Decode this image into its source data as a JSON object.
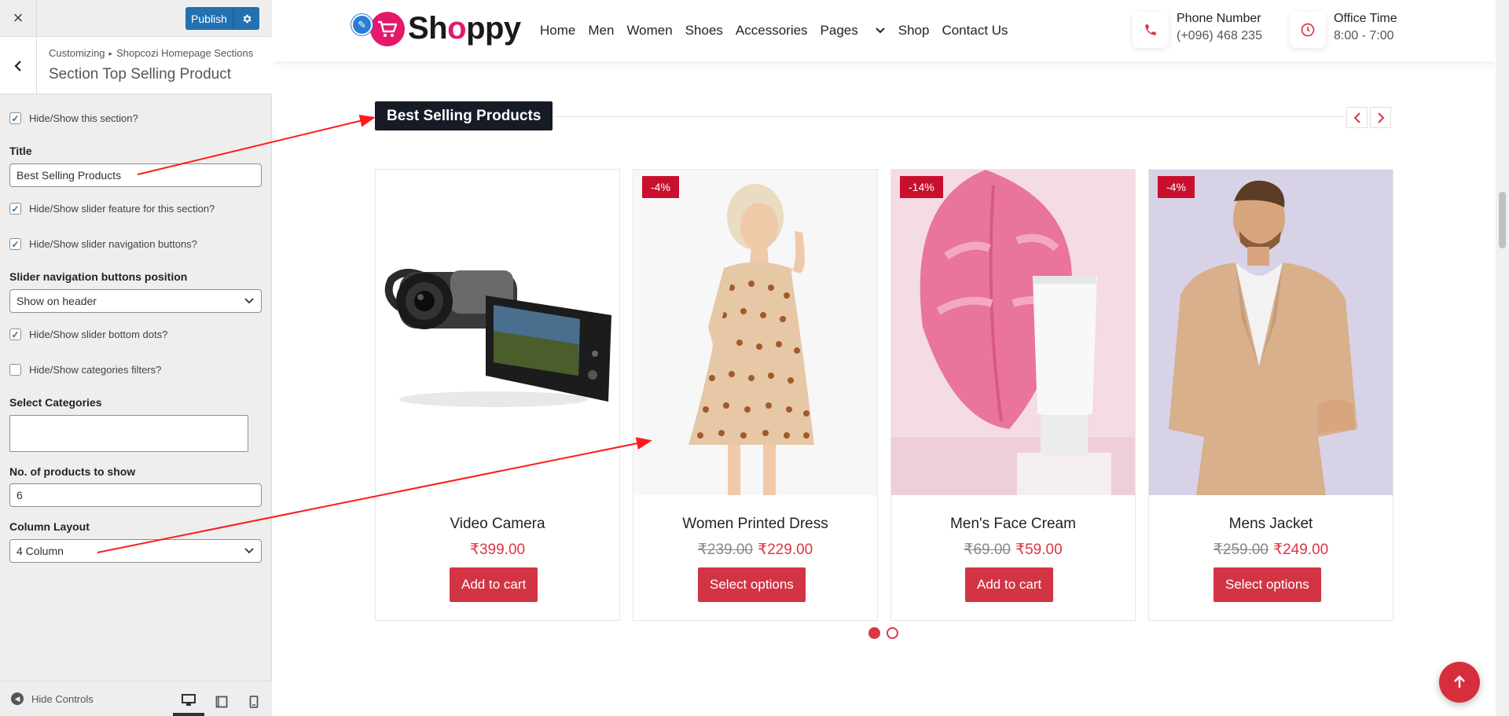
{
  "customizer": {
    "close_icon": "×",
    "publish_label": "Publish",
    "breadcrumb": {
      "root": "Customizing",
      "separator": "▸",
      "section": "Shopcozi Homepage Sections"
    },
    "panel_title": "Section Top Selling Product",
    "controls": {
      "show_section": {
        "label": "Hide/Show this section?",
        "checked": true
      },
      "title_label": "Title",
      "title_value": "Best Selling Products",
      "slider_feature": {
        "label": "Hide/Show slider feature for this section?",
        "checked": true
      },
      "slider_nav": {
        "label": "Hide/Show slider navigation buttons?",
        "checked": true
      },
      "nav_position_label": "Slider navigation buttons position",
      "nav_position_value": "Show on header",
      "slider_dots": {
        "label": "Hide/Show slider bottom dots?",
        "checked": true
      },
      "category_filters": {
        "label": "Hide/Show categories filters?",
        "checked": false
      },
      "select_categories_label": "Select Categories",
      "products_count_label": "No. of products to show",
      "products_count_value": "6",
      "column_layout_label": "Column Layout",
      "column_layout_value": "4 Column"
    },
    "footer": {
      "hide_controls": "Hide Controls",
      "devices": [
        "desktop",
        "tablet",
        "mobile"
      ],
      "active_device": "desktop"
    }
  },
  "site": {
    "logo": {
      "prefix": "Sh",
      "highlight": "o",
      "suffix": "ppy"
    },
    "nav": [
      "Home",
      "Men",
      "Women",
      "Shoes",
      "Accessories",
      "Pages",
      "Shop",
      "Contact Us"
    ],
    "phone": {
      "label": "Phone Number",
      "value": "(+096) 468 235"
    },
    "office": {
      "label": "Office Time",
      "value": "8:00 - 7:00"
    },
    "section_title": "Best Selling Products",
    "products": [
      {
        "name": "Video Camera",
        "badge": "",
        "old_price": "",
        "price": "₹399.00",
        "button": "Add to cart"
      },
      {
        "name": "Women Printed Dress",
        "badge": "-4%",
        "old_price": "₹239.00",
        "price": "₹229.00",
        "button": "Select options"
      },
      {
        "name": "Men's Face Cream",
        "badge": "-14%",
        "old_price": "₹69.00",
        "price": "₹59.00",
        "button": "Add to cart"
      },
      {
        "name": "Mens Jacket",
        "badge": "-4%",
        "old_price": "₹259.00",
        "price": "₹249.00",
        "button": "Select options"
      }
    ],
    "pagination": {
      "pages": 2,
      "active": 1
    }
  },
  "colors": {
    "accent": "#dc3545",
    "wp_blue": "#2271b1",
    "logo_pink": "#e3196b",
    "title_bg": "#161b26"
  }
}
